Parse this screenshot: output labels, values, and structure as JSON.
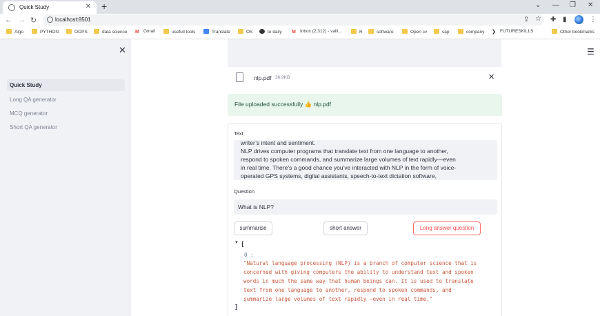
{
  "browser": {
    "tab_title": "Quick Study",
    "url": "localhost:8501",
    "bookmarks": [
      "Algo",
      "PYTHON",
      "OOPS",
      "data science",
      "Gmail",
      "usefull tools",
      "Translate",
      "OS",
      "to daily",
      "Inbox (2,312) - valli...",
      "R",
      "software",
      "Open cv",
      "sap",
      "company",
      "FUTURESKILLS",
      "Other bookmarks"
    ]
  },
  "sidebar": {
    "items": [
      {
        "label": "Quick Study",
        "active": true
      },
      {
        "label": "Long QA generator",
        "active": false
      },
      {
        "label": "MCQ generator",
        "active": false
      },
      {
        "label": "Short QA generator",
        "active": false
      }
    ]
  },
  "uploader": {
    "file_name": "nlp.pdf",
    "file_size": "36.9KB",
    "success_message": "File uploaded successfully 👍 nlp.pdf"
  },
  "form": {
    "text_label": "Text",
    "text_lines": [
      "writer’s intent and sentiment.",
      "NLP drives computer programs that translate text from one language to another,",
      "respond to spoken commands, and summarize large volumes of text rapidly—even",
      "in real time. There’s a good  chance you’ve interacted with NLP in the form of voice-",
      "operated GPS systems, digital assistants, speech-to-text dictation software,"
    ],
    "question_label": "Question",
    "question_value": "What is NLP?",
    "buttons": {
      "summarise": "summarise",
      "short_answer": "short answer",
      "long_answer": "Long answer question"
    }
  },
  "output": {
    "open_bracket": "[",
    "index": "0 :",
    "lines": [
      "\"Natural language processing (NLP) is a branch of computer science that is",
      "concerned with giving computers the ability to understand text and spoken",
      "words in much the same way that human beings can. It is used to translate",
      "text from one language to another, respond to spoken commands, and",
      "summarize large volumes of text rapidly —even in real time.\""
    ],
    "close_bracket": "]"
  }
}
